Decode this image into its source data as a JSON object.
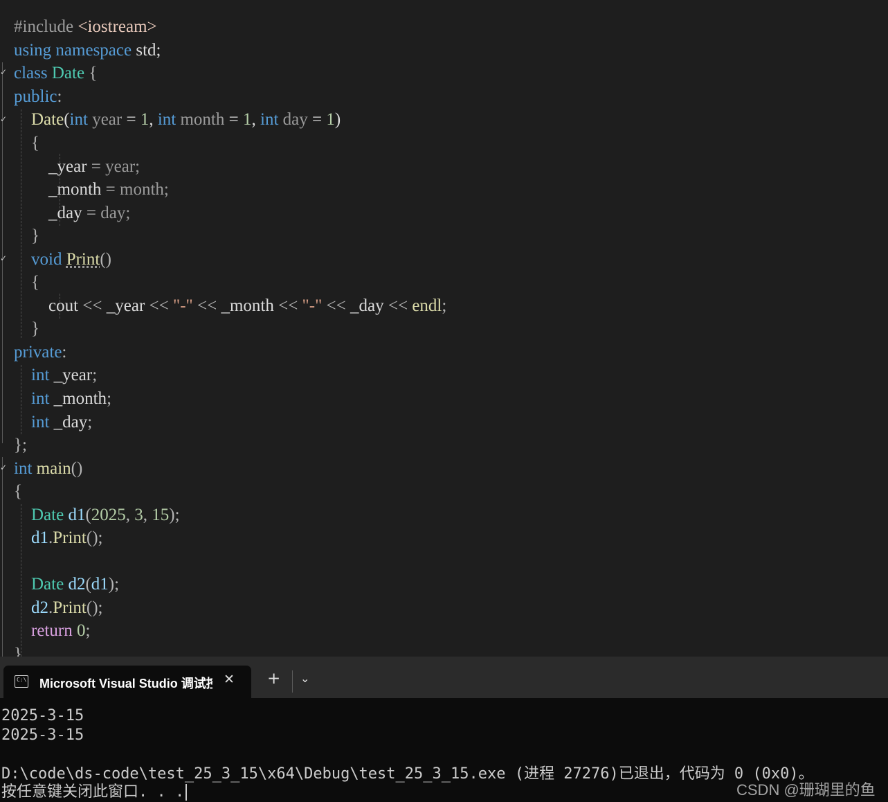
{
  "editor": {
    "lines": [
      "#include <iostream>",
      "using namespace std;",
      "class Date {",
      "public:",
      "    Date(int year = 1, int month = 1, int day = 1)",
      "    {",
      "        _year = year;",
      "        _month = month;",
      "        _day = day;",
      "    }",
      "    void Print()",
      "    {",
      "        cout << _year << \"-\" << _month << \"-\" << _day << endl;",
      "    }",
      "private:",
      "    int _year;",
      "    int _month;",
      "    int _day;",
      "};",
      "int main()",
      "{",
      "    Date d1(2025, 3, 15);",
      "    d1.Print();",
      "",
      "    Date d2(d1);",
      "    d2.Print();",
      "    return 0;",
      "}"
    ]
  },
  "terminal": {
    "tab_title": "Microsoft Visual Studio 调试控制台",
    "icon_text": "C:\\",
    "close_glyph": "✕",
    "new_tab_glyph": "+",
    "dropdown_glyph": "⌄",
    "output": [
      "2025-3-15",
      "2025-3-15",
      "",
      "D:\\code\\ds-code\\test_25_3_15\\x64\\Debug\\test_25_3_15.exe (进程 27276)已退出，代码为 0 (0x0)。",
      "按任意键关闭此窗口. . ."
    ]
  },
  "watermark": "CSDN @珊瑚里的鱼",
  "colors": {
    "keyword": "#569cd6",
    "type": "#4ec9b0",
    "function": "#dcdcaa",
    "number": "#b5cea8",
    "string": "#d69d85",
    "preprocessor": "#9b9b9b",
    "parameter": "#9a9a9a",
    "control": "#d8a0df",
    "editor_bg": "#1e1e1e",
    "terminal_bg": "#0c0c0c",
    "tabbar_bg": "#2b2b2b"
  }
}
